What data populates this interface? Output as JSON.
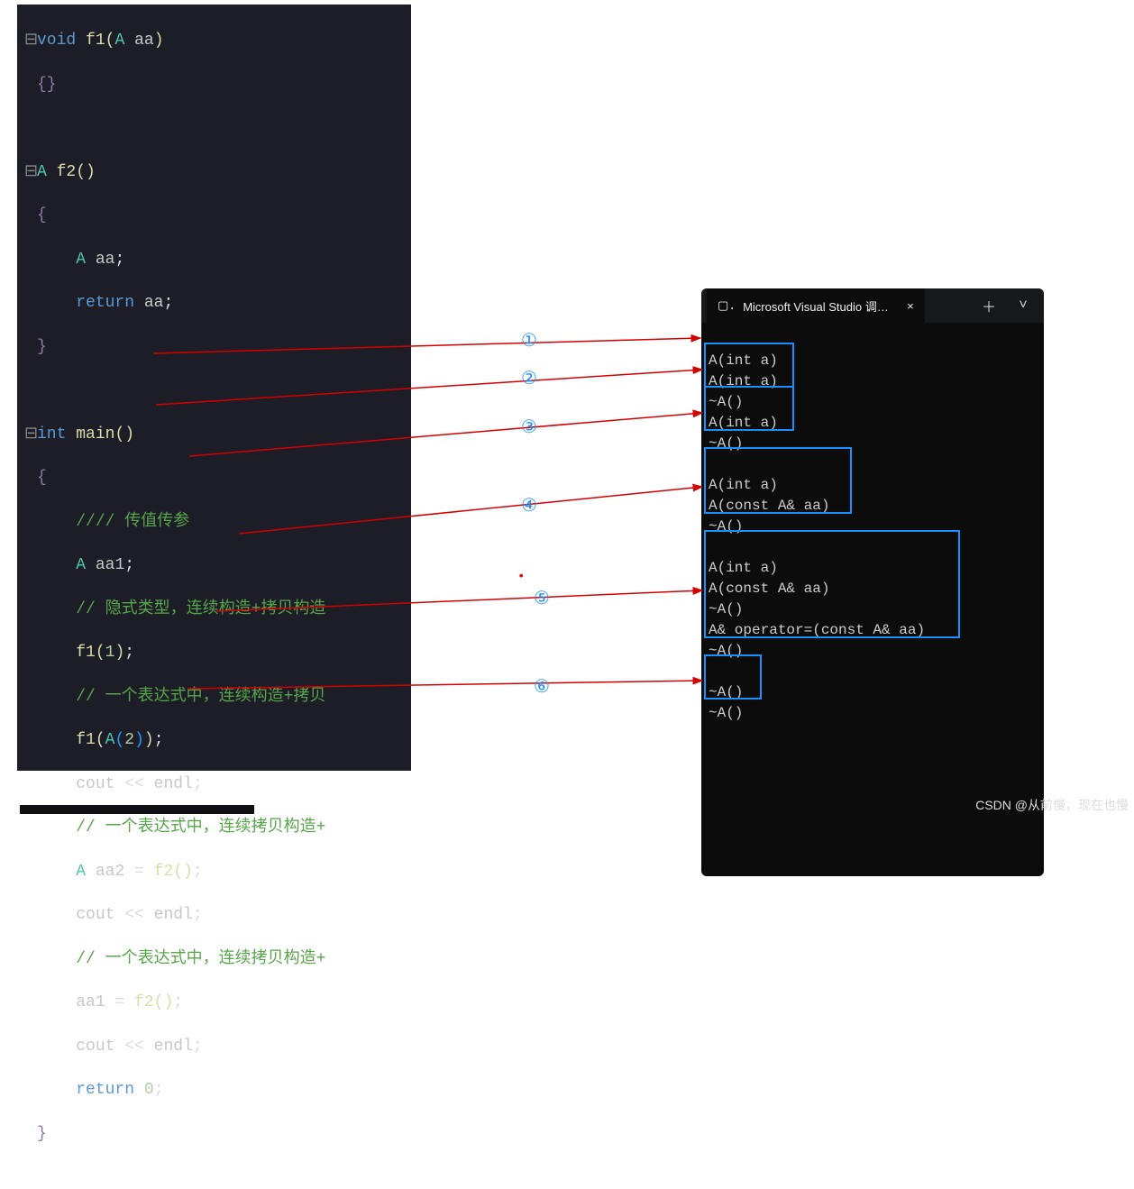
{
  "editor": {
    "lines": {
      "l1": {
        "tokens": [
          "void",
          " ",
          "f1",
          "(",
          "A",
          " ",
          "aa",
          ")"
        ]
      },
      "l2": "{}",
      "l3": "",
      "l4": {
        "tokens": [
          "A",
          " ",
          "f2",
          "()"
        ]
      },
      "l5": "{",
      "l6": {
        "tokens": [
          "A",
          " ",
          "aa",
          ";"
        ]
      },
      "l7": {
        "tokens": [
          "return",
          " ",
          "aa",
          ";"
        ]
      },
      "l8": "}",
      "l9": "",
      "l10": {
        "tokens": [
          "int",
          " ",
          "main",
          "()"
        ]
      },
      "l11": "{",
      "l12": "//// 传值传参",
      "l13": {
        "tokens": [
          "A",
          " ",
          "aa1",
          ";"
        ]
      },
      "l14": "// 隐式类型，连续构造+拷贝构造",
      "l15": {
        "tokens": [
          "f1",
          "(",
          "1",
          ")",
          ";"
        ]
      },
      "l16": "// 一个表达式中，连续构造+拷贝",
      "l17": {
        "tokens": [
          "f1",
          "(",
          "A",
          "(",
          "2",
          ")",
          ")",
          ";"
        ]
      },
      "l18": {
        "tokens": [
          "cout",
          " << ",
          "endl",
          ";"
        ]
      },
      "l19": "// 一个表达式中，连续拷贝构造+",
      "l20": {
        "tokens": [
          "A",
          " ",
          "aa2",
          " = ",
          "f2",
          "()",
          ";"
        ]
      },
      "l21": {
        "tokens": [
          "cout",
          " << ",
          "endl",
          ";"
        ]
      },
      "l22": "// 一个表达式中，连续拷贝构造+",
      "l23": {
        "tokens": [
          "aa1",
          " = ",
          "f2",
          "()",
          ";"
        ]
      },
      "l24": {
        "tokens": [
          "cout",
          " << ",
          "endl",
          ";"
        ]
      },
      "l25": {
        "tokens": [
          "return",
          " ",
          "0",
          ";"
        ]
      },
      "l26": "}"
    }
  },
  "console": {
    "tab_title": "Microsoft Visual Studio 调试控",
    "close_symbol": "×",
    "add_symbol": "＋",
    "chevron_symbol": "˅",
    "lines": [
      "A(int a)",
      "A(int a)",
      "~A()",
      "A(int a)",
      "~A()",
      "",
      "A(int a)",
      "A(const A& aa)",
      "~A()",
      "",
      "A(int a)",
      "A(const A& aa)",
      "~A()",
      "A& operator=(const A& aa)",
      "~A()",
      "",
      "~A()",
      "~A()"
    ]
  },
  "annotations": {
    "a1": "①",
    "a2": "②",
    "a3": "③",
    "a4": "④",
    "a5": "⑤",
    "a6": "⑥"
  },
  "watermark": "CSDN @从前慢，现在也慢"
}
